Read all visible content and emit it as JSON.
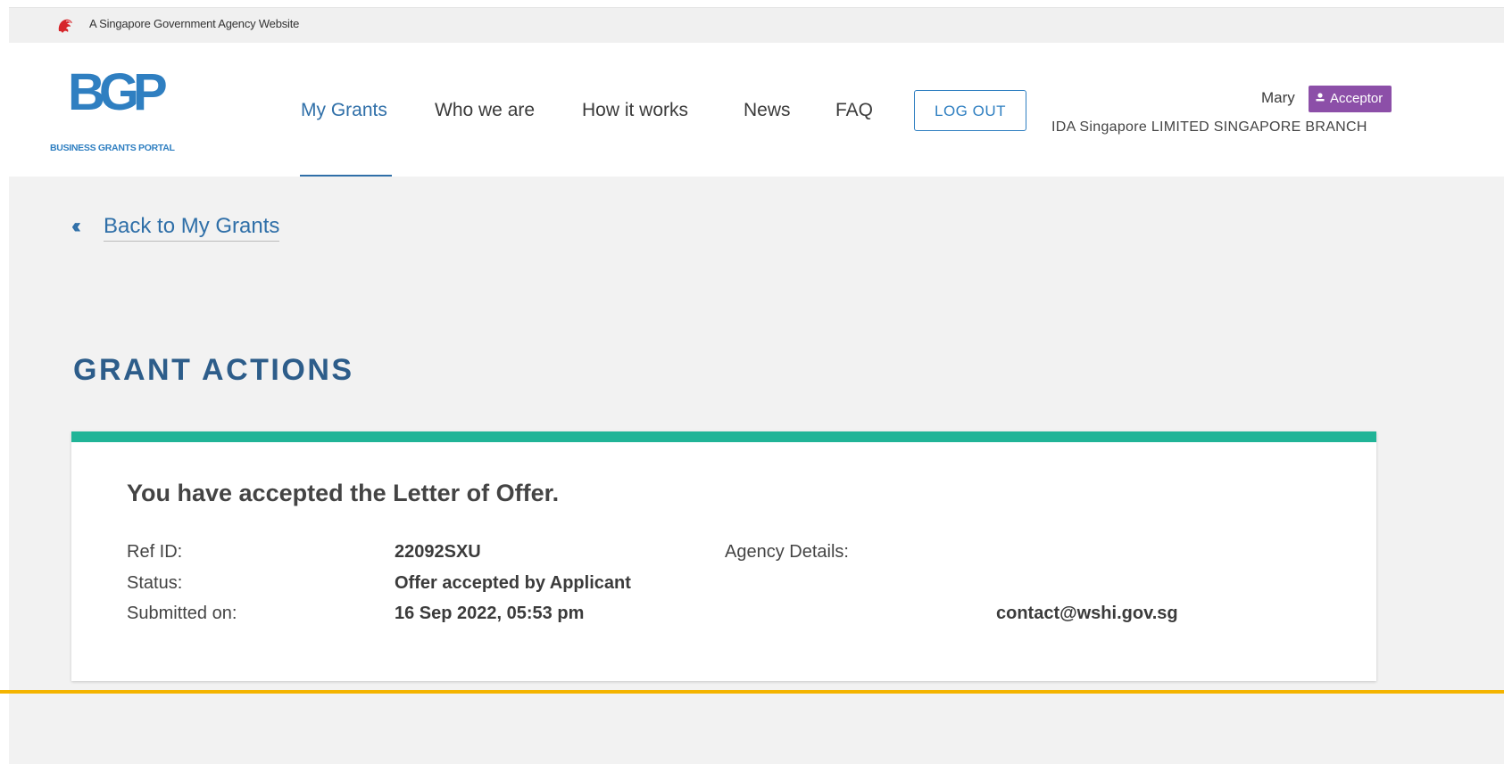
{
  "masthead": {
    "text": "A Singapore Government Agency Website"
  },
  "logo": {
    "wordmark": "BGP",
    "tagline": "BUSINESS GRANTS PORTAL"
  },
  "nav": {
    "items": [
      {
        "label": "My Grants",
        "active": true
      },
      {
        "label": "Who we are",
        "active": false
      },
      {
        "label": "How it works",
        "active": false
      },
      {
        "label": "News",
        "active": false
      },
      {
        "label": "FAQ",
        "active": false
      }
    ],
    "logout_label": "LOG OUT"
  },
  "user": {
    "name": "Mary",
    "role": "Acceptor",
    "company": "IDA Singapore LIMITED SINGAPORE BRANCH"
  },
  "back_link": {
    "label": "Back to My Grants"
  },
  "section_title": "GRANT ACTIONS",
  "card": {
    "heading": "You have accepted the Letter of Offer.",
    "fields": [
      {
        "label": "Ref ID:",
        "value": "22092SXU"
      },
      {
        "label": "Status:",
        "value": "Offer accepted by Applicant"
      },
      {
        "label": "Submitted on:",
        "value": "16 Sep 2022, 05:53 pm"
      }
    ],
    "agency_label": "Agency Details:",
    "agency_email": "contact@wshi.gov.sg"
  },
  "colors": {
    "brand_blue": "#2f7fc1",
    "title_blue": "#2d5d8a",
    "card_accent": "#20b497",
    "role_badge": "#8c4fa8",
    "bottom_rule": "#f4b400"
  }
}
